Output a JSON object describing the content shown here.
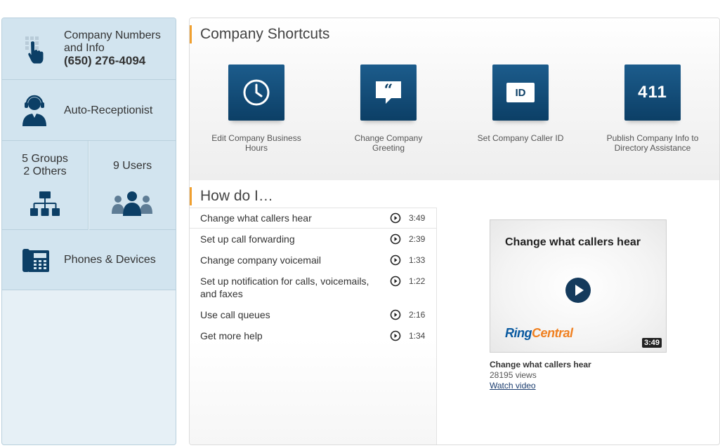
{
  "sidebar": {
    "numbers": {
      "title": "Company Numbers and Info",
      "phone": "(650) 276-4094",
      "icon": "touch-keypad-icon"
    },
    "auto_receptionist": {
      "label": "Auto-Receptionist",
      "icon": "headset-operator-icon"
    },
    "groups": {
      "line1": "5 Groups",
      "line2": "2 Others",
      "icon": "org-chart-icon"
    },
    "users": {
      "label": "9 Users",
      "icon": "users-group-icon"
    },
    "phones": {
      "label": "Phones & Devices",
      "icon": "desk-phone-icon"
    }
  },
  "shortcuts": {
    "title": "Company Shortcuts",
    "items": [
      {
        "label": "Edit Company Business Hours",
        "icon": "clock-icon"
      },
      {
        "label": "Change Company Greeting",
        "icon": "speech-bubble-icon"
      },
      {
        "label": "Set Company Caller ID",
        "icon": "id-card-icon",
        "glyph": "ID"
      },
      {
        "label": "Publish Company Info to Directory Assistance",
        "icon": "directory-411-icon",
        "glyph": "411"
      }
    ]
  },
  "howdo": {
    "title": "How do I…",
    "items": [
      {
        "label": "Change what callers hear",
        "duration": "3:49"
      },
      {
        "label": "Set up call forwarding",
        "duration": "2:39"
      },
      {
        "label": "Change company voicemail",
        "duration": "1:33"
      },
      {
        "label": "Set up notification for calls, voicemails, and faxes",
        "duration": "1:22"
      },
      {
        "label": "Use call queues",
        "duration": "2:16"
      },
      {
        "label": "Get more help",
        "duration": "1:34"
      }
    ]
  },
  "video": {
    "title": "Change what callers hear",
    "brand_part1": "Ring",
    "brand_part2": "Central",
    "duration": "3:49",
    "caption_title": "Change what callers hear",
    "views": "28195 views",
    "link": "Watch video"
  },
  "colors": {
    "accent": "#f0a030",
    "tile_blue": "#0c3f66",
    "sidebar_bg": "#d2e4ef",
    "brand_blue": "#0a5aa0",
    "brand_orange": "#f08020"
  }
}
